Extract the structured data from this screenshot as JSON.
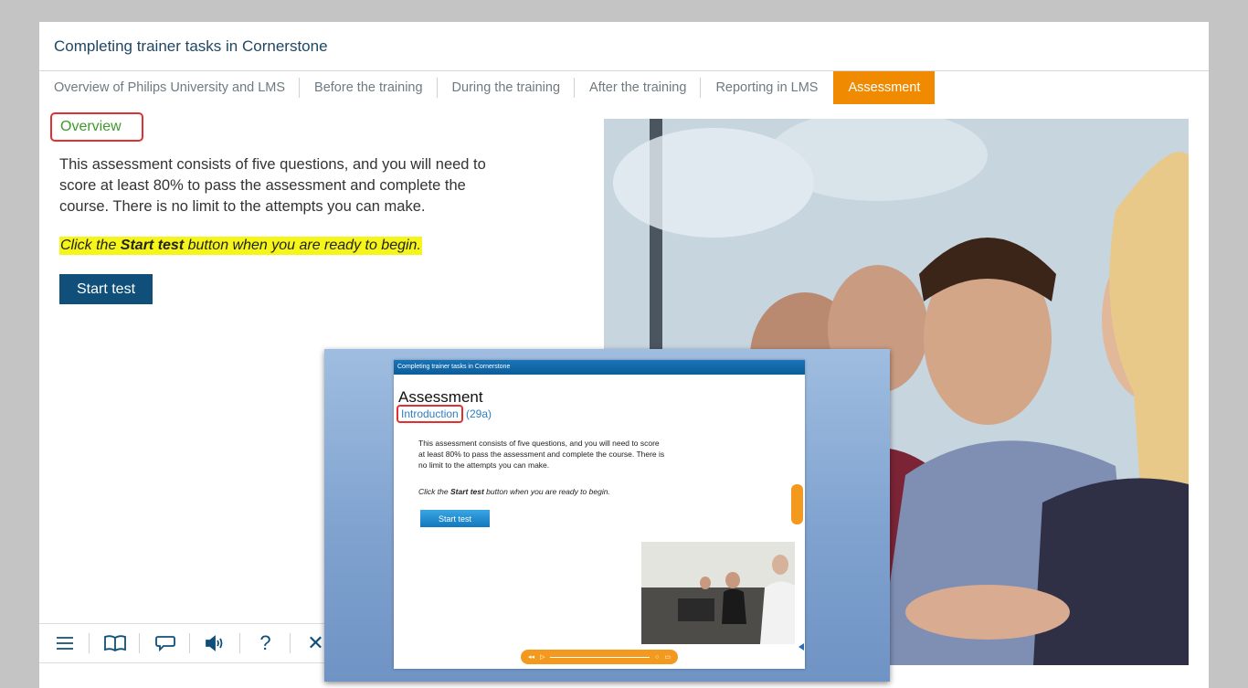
{
  "course": {
    "title": "Completing trainer tasks in Cornerstone"
  },
  "nav": {
    "items": [
      {
        "label": "Overview of Philips University and LMS"
      },
      {
        "label": "Before the training"
      },
      {
        "label": "During the training"
      },
      {
        "label": "After the training"
      },
      {
        "label": "Reporting in LMS"
      },
      {
        "label": "Assessment",
        "active": true
      }
    ]
  },
  "main": {
    "section_label": "Overview",
    "description": "This assessment consists of five questions, and you will need to score at least 80% to pass the assessment and complete the course. There is no limit to the attempts you can make.",
    "instruction_before": "Click the ",
    "instruction_bold": "Start test",
    "instruction_after": " button when you are ready to begin.",
    "start_button": "Start test"
  },
  "toolbar": {
    "icons": [
      "menu-icon",
      "book-icon",
      "comment-icon",
      "volume-icon",
      "help-icon",
      "close-icon"
    ],
    "help_glyph": "?",
    "close_glyph": "✕"
  },
  "overlay": {
    "bar_title": "Completing trainer tasks in Cornerstone",
    "title": "Assessment",
    "subtitle": "Introduction",
    "code": "(29a)",
    "text": "This assessment consists of five questions,  and you will  need to score at least 80% to pass the assessment and complete the course. There is no limit to the attempts you can make.",
    "instruction_before": "Click the ",
    "instruction_bold": "Start test",
    "instruction_after": " button when you are ready to begin.",
    "start_button": "Start test"
  },
  "colors": {
    "accent_orange": "#f08a00",
    "primary_blue": "#0f4f7a",
    "overview_green": "#3e9a2c",
    "highlight_yellow": "#f5f51a",
    "callout_red": "#e23030"
  }
}
